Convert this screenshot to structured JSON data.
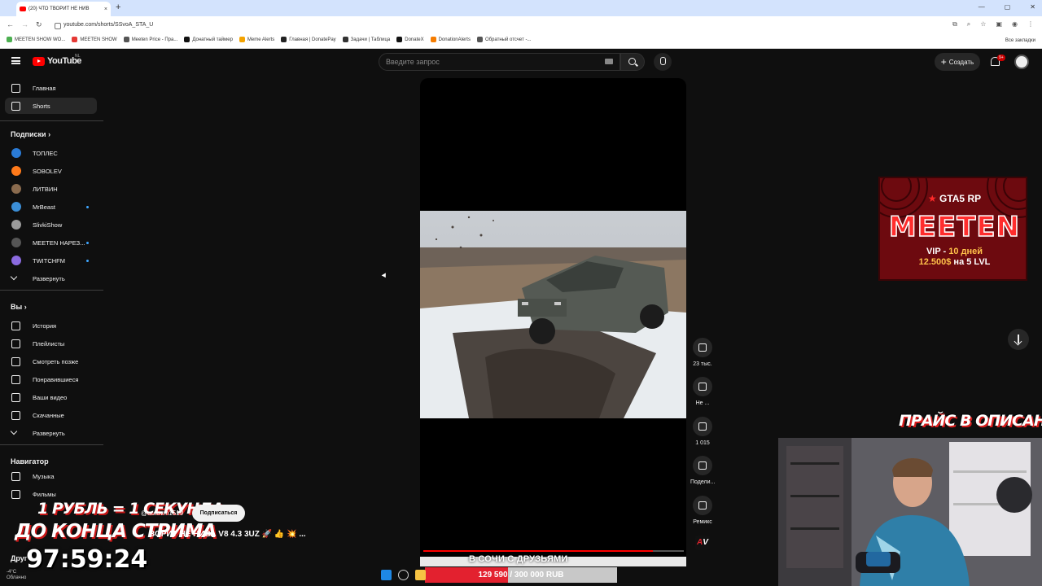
{
  "browser": {
    "tab_title": "(20) ЧТО ТВОРИТ НЕ НИВ",
    "tab_close": "×",
    "new_tab": "+",
    "url": "youtube.com/shorts/SSvoA_STA_U",
    "all_bookmarks": "Все закладки",
    "bookmarks": [
      {
        "label": "MEETEN SHOW WO...",
        "color": "#4caf50"
      },
      {
        "label": "MEETEN SHOW",
        "color": "#e53935"
      },
      {
        "label": "Meeten Price - Пра...",
        "color": "#555555"
      },
      {
        "label": "Донатный таймер",
        "color": "#111111"
      },
      {
        "label": "Meme Alerts",
        "color": "#f4a300"
      },
      {
        "label": "Главная | DonatePay",
        "color": "#222222"
      },
      {
        "label": "Задачи | Таблица",
        "color": "#333333"
      },
      {
        "label": "DonateX",
        "color": "#111111"
      },
      {
        "label": "DonationAlerts",
        "color": "#f57c00"
      },
      {
        "label": "Обратный отсчет -...",
        "color": "#555555"
      }
    ]
  },
  "yt": {
    "logo_text": "YouTube",
    "country": "NL",
    "search_placeholder": "Введите запрос",
    "create_label": "Создать",
    "notif_count": "9+"
  },
  "sidebar": {
    "main": [
      {
        "label": "Главная",
        "icon": "home-icon"
      },
      {
        "label": "Shorts",
        "icon": "shorts-icon",
        "active": true
      }
    ],
    "subs_header": "Подписки",
    "subs": [
      {
        "label": "ТОПЛЕС",
        "color": "#2a7bd6",
        "dot": false
      },
      {
        "label": "SOBOLEV",
        "color": "#ff7a1a",
        "dot": false
      },
      {
        "label": "ЛИТВИН",
        "color": "#8a6b4e",
        "dot": false
      },
      {
        "label": "MrBeast",
        "color": "#3b8ed6",
        "dot": true
      },
      {
        "label": "SlivkiShow",
        "color": "#9a9a9a",
        "dot": false
      },
      {
        "label": "MEETEN НАРЕЗ...",
        "color": "#555555",
        "dot": true
      },
      {
        "label": "TWITCHFM",
        "color": "#8b6be0",
        "dot": true
      }
    ],
    "subs_expand": "Развернуть",
    "you_header": "Вы",
    "you": [
      {
        "label": "История",
        "icon": "history-icon"
      },
      {
        "label": "Плейлисты",
        "icon": "playlists-icon"
      },
      {
        "label": "Смотреть позже",
        "icon": "watch-later-icon"
      },
      {
        "label": "Понравившиеся",
        "icon": "like-icon"
      },
      {
        "label": "Ваши видео",
        "icon": "your-videos-icon"
      },
      {
        "label": "Скачанные",
        "icon": "download-icon"
      }
    ],
    "you_expand": "Развернуть",
    "nav_header": "Навигатор",
    "nav": [
      {
        "label": "Музыка",
        "icon": "music-icon"
      },
      {
        "label": "Фильмы",
        "icon": "movies-icon"
      }
    ],
    "other_header": "Друг"
  },
  "short": {
    "channel_handle": "@autovm1519",
    "subscribe_label": "Подписаться",
    "title": "ВОРИТ НЕ НИВА V8 4.3 3UZ 🚀 👍 💥 ...",
    "overlay_caption": "В СОЧИ С ДРУЗЬЯМИ",
    "progress": 0.88,
    "actions": {
      "likes": "23 тыс.",
      "dislike": "Не ...",
      "comments": "1 015",
      "share": "Подели...",
      "remix": "Ремикс"
    },
    "channel_mini": {
      "a": "A",
      "v": "V"
    }
  },
  "stream": {
    "promo_gta": "GTA5",
    "promo_rp": "RP",
    "promo_title": "MEETEN",
    "promo_vip_1": "VIP - ",
    "promo_vip_2": "10 дней",
    "promo_vip_3": "12.500$",
    "promo_vip_4": " на 5 LVL",
    "price_text": "ПРАЙС В ОПИСАНИИ",
    "timer_line1": "1 РУБЛЬ = 1 СЕКУНДА",
    "timer_line2": "ДО КОНЦА СТРИМА",
    "timer_value": "97:59:24",
    "donation_text": "129 590 / 300 000 RUB",
    "donation_progress": 0.432
  },
  "taskbar": {
    "weather_temp": "-4°C",
    "weather_desc": "Облачно"
  }
}
